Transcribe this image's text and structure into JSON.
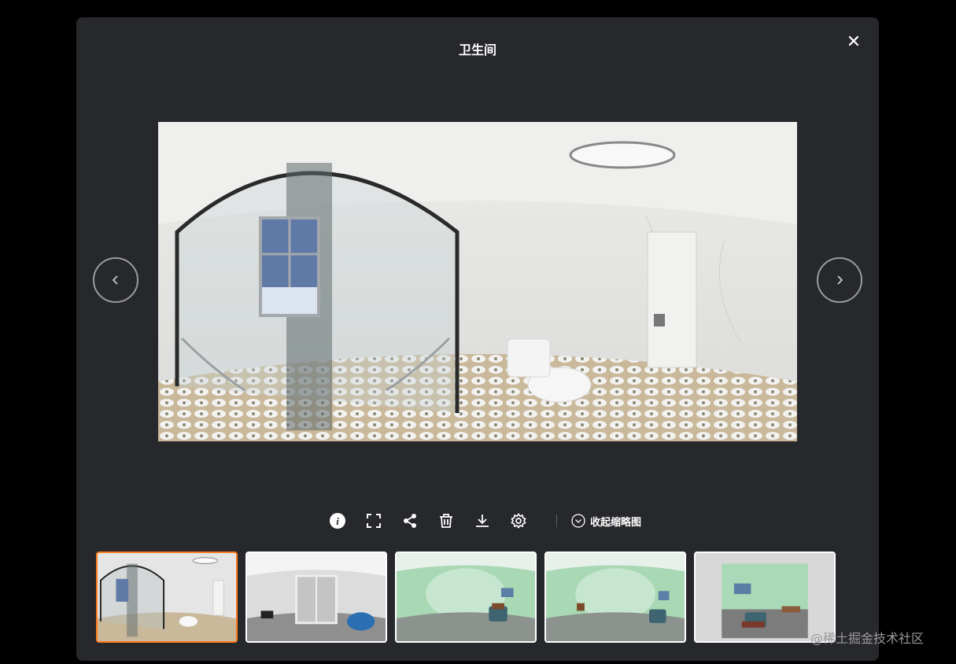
{
  "viewer": {
    "title": "卫生间",
    "close_icon": "close-icon",
    "prev_icon": "chevron-left-icon",
    "next_icon": "chevron-right-icon",
    "image_description_icon": "panorama-image"
  },
  "toolbar": {
    "items": [
      {
        "name": "info-icon"
      },
      {
        "name": "fullscreen-icon"
      },
      {
        "name": "share-icon"
      },
      {
        "name": "delete-icon"
      },
      {
        "name": "download-icon"
      },
      {
        "name": "settings-icon"
      }
    ],
    "collapse_label": "收起缩略图",
    "collapse_icon": "chevron-down-circle-icon"
  },
  "thumbnails": {
    "active_index": 0,
    "items": [
      {
        "scene": "bathroom"
      },
      {
        "scene": "white-room"
      },
      {
        "scene": "green-room"
      },
      {
        "scene": "green-room"
      },
      {
        "scene": "green-room-box"
      }
    ]
  },
  "watermark": "@稀土掘金技术社区",
  "colors": {
    "accent": "#ff7a1a",
    "modal_bg": "#27282c",
    "page_bg": "#000000"
  }
}
